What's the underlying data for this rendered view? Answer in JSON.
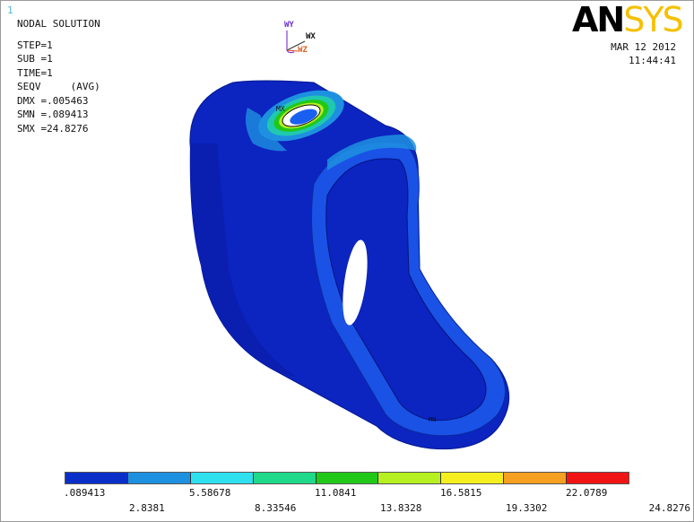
{
  "window_number": "1",
  "info": {
    "title": "NODAL SOLUTION",
    "step": "STEP=1",
    "sub": "SUB =1",
    "time": "TIME=1",
    "seqv": "SEQV     (AVG)",
    "dmx": "DMX =.005463",
    "smn": "SMN =.089413",
    "smx": "SMX =24.8276"
  },
  "logo": {
    "part1": "AN",
    "part2": "SYS",
    "colors": {
      "an": "#000000",
      "sys": "#f5c000"
    }
  },
  "date": {
    "line1": "MAR 12 2012",
    "line2": "11:44:41"
  },
  "triad": {
    "y_label": "WY",
    "x_label": "WX",
    "z_label": "WZ"
  },
  "model_labels": {
    "mx": "MX",
    "mn": "MN"
  },
  "legend": {
    "colors": [
      "#0a2fc8",
      "#1e90e0",
      "#2fe0ef",
      "#20d88a",
      "#22c818",
      "#b6f020",
      "#f5ef20",
      "#f5a020",
      "#f01414"
    ],
    "top_ticks": [
      ".089413",
      "5.58678",
      "11.0841",
      "16.5815",
      "22.0789"
    ],
    "bottom_ticks": [
      "2.8381",
      "8.33546",
      "13.8328",
      "19.3302",
      "24.8276"
    ]
  }
}
